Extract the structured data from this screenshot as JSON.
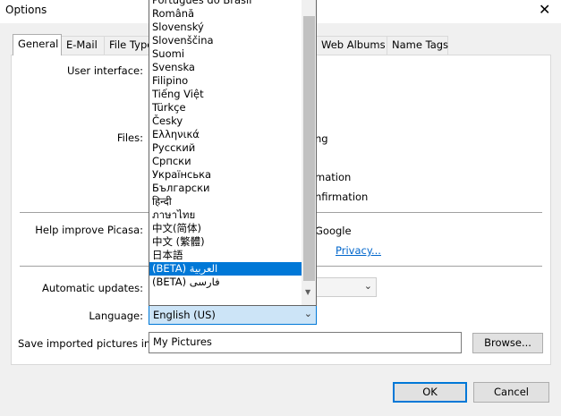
{
  "window": {
    "title": "Options",
    "close_glyph": "✕"
  },
  "tabs": [
    {
      "label": "General",
      "active": true
    },
    {
      "label": "E-Mail"
    },
    {
      "label": "File Types"
    },
    {
      "label": "Web Albums"
    },
    {
      "label": "Name Tags"
    }
  ],
  "general": {
    "user_interface_label": "User interface:",
    "files_label": "Files:",
    "files_fragments": [
      "ng",
      "mation",
      "nfirmation"
    ],
    "help_improve_label": "Help improve Picasa:",
    "help_improve_fragment": "Google",
    "privacy_link": "Privacy...",
    "automatic_updates_label": "Automatic updates:",
    "language_label": "Language:",
    "language_value": "English (US)",
    "save_imported_label": "Save imported pictures in:",
    "save_imported_value": "My Pictures",
    "browse_label": "Browse..."
  },
  "language_dropdown": {
    "items": [
      "Português do Brasil",
      "Română",
      "Slovenský",
      "Slovenščina",
      "Suomi",
      "Svenska",
      "Filipino",
      "Tiếng Việt",
      "Türkçe",
      "Česky",
      "Ελληνικά",
      "Русский",
      "Српски",
      "Українська",
      "Български",
      "हिन्दी",
      "ภาษาไทย",
      "中文(简体)",
      "中文 (繁體)",
      "日本語",
      "(BETA) العربية",
      "(BETA) فارسی"
    ],
    "selected": "(BETA) العربية"
  },
  "footer": {
    "ok_label": "OK",
    "cancel_label": "Cancel"
  },
  "colors": {
    "accent": "#0078d7",
    "link": "#0066cc"
  },
  "icons": {
    "close": "close-icon",
    "dropdown_arrow": "chevron-down-icon"
  }
}
